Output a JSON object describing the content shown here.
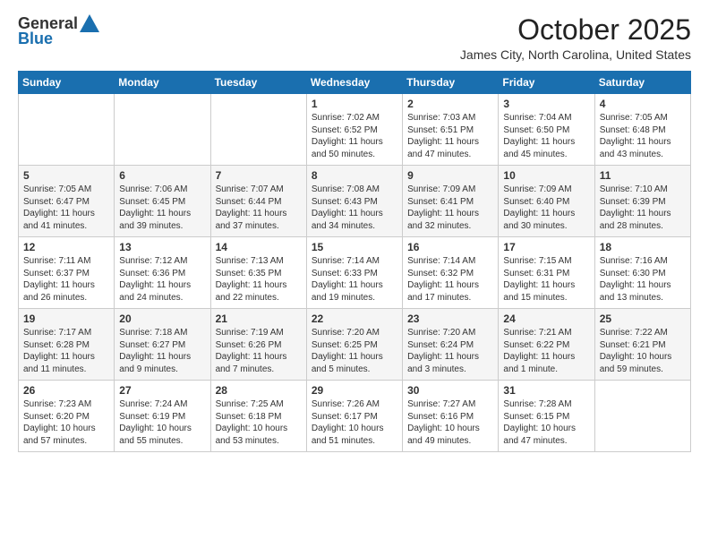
{
  "logo": {
    "general": "General",
    "blue": "Blue"
  },
  "header": {
    "title": "October 2025",
    "subtitle": "James City, North Carolina, United States"
  },
  "weekdays": [
    "Sunday",
    "Monday",
    "Tuesday",
    "Wednesday",
    "Thursday",
    "Friday",
    "Saturday"
  ],
  "weeks": [
    [
      {
        "day": "",
        "info": ""
      },
      {
        "day": "",
        "info": ""
      },
      {
        "day": "",
        "info": ""
      },
      {
        "day": "1",
        "info": "Sunrise: 7:02 AM\nSunset: 6:52 PM\nDaylight: 11 hours\nand 50 minutes."
      },
      {
        "day": "2",
        "info": "Sunrise: 7:03 AM\nSunset: 6:51 PM\nDaylight: 11 hours\nand 47 minutes."
      },
      {
        "day": "3",
        "info": "Sunrise: 7:04 AM\nSunset: 6:50 PM\nDaylight: 11 hours\nand 45 minutes."
      },
      {
        "day": "4",
        "info": "Sunrise: 7:05 AM\nSunset: 6:48 PM\nDaylight: 11 hours\nand 43 minutes."
      }
    ],
    [
      {
        "day": "5",
        "info": "Sunrise: 7:05 AM\nSunset: 6:47 PM\nDaylight: 11 hours\nand 41 minutes."
      },
      {
        "day": "6",
        "info": "Sunrise: 7:06 AM\nSunset: 6:45 PM\nDaylight: 11 hours\nand 39 minutes."
      },
      {
        "day": "7",
        "info": "Sunrise: 7:07 AM\nSunset: 6:44 PM\nDaylight: 11 hours\nand 37 minutes."
      },
      {
        "day": "8",
        "info": "Sunrise: 7:08 AM\nSunset: 6:43 PM\nDaylight: 11 hours\nand 34 minutes."
      },
      {
        "day": "9",
        "info": "Sunrise: 7:09 AM\nSunset: 6:41 PM\nDaylight: 11 hours\nand 32 minutes."
      },
      {
        "day": "10",
        "info": "Sunrise: 7:09 AM\nSunset: 6:40 PM\nDaylight: 11 hours\nand 30 minutes."
      },
      {
        "day": "11",
        "info": "Sunrise: 7:10 AM\nSunset: 6:39 PM\nDaylight: 11 hours\nand 28 minutes."
      }
    ],
    [
      {
        "day": "12",
        "info": "Sunrise: 7:11 AM\nSunset: 6:37 PM\nDaylight: 11 hours\nand 26 minutes."
      },
      {
        "day": "13",
        "info": "Sunrise: 7:12 AM\nSunset: 6:36 PM\nDaylight: 11 hours\nand 24 minutes."
      },
      {
        "day": "14",
        "info": "Sunrise: 7:13 AM\nSunset: 6:35 PM\nDaylight: 11 hours\nand 22 minutes."
      },
      {
        "day": "15",
        "info": "Sunrise: 7:14 AM\nSunset: 6:33 PM\nDaylight: 11 hours\nand 19 minutes."
      },
      {
        "day": "16",
        "info": "Sunrise: 7:14 AM\nSunset: 6:32 PM\nDaylight: 11 hours\nand 17 minutes."
      },
      {
        "day": "17",
        "info": "Sunrise: 7:15 AM\nSunset: 6:31 PM\nDaylight: 11 hours\nand 15 minutes."
      },
      {
        "day": "18",
        "info": "Sunrise: 7:16 AM\nSunset: 6:30 PM\nDaylight: 11 hours\nand 13 minutes."
      }
    ],
    [
      {
        "day": "19",
        "info": "Sunrise: 7:17 AM\nSunset: 6:28 PM\nDaylight: 11 hours\nand 11 minutes."
      },
      {
        "day": "20",
        "info": "Sunrise: 7:18 AM\nSunset: 6:27 PM\nDaylight: 11 hours\nand 9 minutes."
      },
      {
        "day": "21",
        "info": "Sunrise: 7:19 AM\nSunset: 6:26 PM\nDaylight: 11 hours\nand 7 minutes."
      },
      {
        "day": "22",
        "info": "Sunrise: 7:20 AM\nSunset: 6:25 PM\nDaylight: 11 hours\nand 5 minutes."
      },
      {
        "day": "23",
        "info": "Sunrise: 7:20 AM\nSunset: 6:24 PM\nDaylight: 11 hours\nand 3 minutes."
      },
      {
        "day": "24",
        "info": "Sunrise: 7:21 AM\nSunset: 6:22 PM\nDaylight: 11 hours\nand 1 minute."
      },
      {
        "day": "25",
        "info": "Sunrise: 7:22 AM\nSunset: 6:21 PM\nDaylight: 10 hours\nand 59 minutes."
      }
    ],
    [
      {
        "day": "26",
        "info": "Sunrise: 7:23 AM\nSunset: 6:20 PM\nDaylight: 10 hours\nand 57 minutes."
      },
      {
        "day": "27",
        "info": "Sunrise: 7:24 AM\nSunset: 6:19 PM\nDaylight: 10 hours\nand 55 minutes."
      },
      {
        "day": "28",
        "info": "Sunrise: 7:25 AM\nSunset: 6:18 PM\nDaylight: 10 hours\nand 53 minutes."
      },
      {
        "day": "29",
        "info": "Sunrise: 7:26 AM\nSunset: 6:17 PM\nDaylight: 10 hours\nand 51 minutes."
      },
      {
        "day": "30",
        "info": "Sunrise: 7:27 AM\nSunset: 6:16 PM\nDaylight: 10 hours\nand 49 minutes."
      },
      {
        "day": "31",
        "info": "Sunrise: 7:28 AM\nSunset: 6:15 PM\nDaylight: 10 hours\nand 47 minutes."
      },
      {
        "day": "",
        "info": ""
      }
    ]
  ]
}
